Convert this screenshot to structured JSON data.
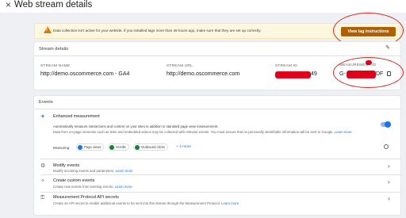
{
  "header": {
    "close_icon": "×",
    "title": "Web stream details"
  },
  "banner": {
    "text": "Data collection isn't active for your website. If you installed tags more than 48 hours ago, make sure that they are set up correctly.",
    "button": "View tag instructions"
  },
  "stream_details": {
    "title": "Stream details",
    "stream_name_label": "STREAM NAME",
    "stream_name": "http://demo.oscommerce.com - GA4",
    "stream_url_label": "STREAM URL",
    "stream_url": "http://demo.oscommerce.com",
    "stream_id_label": "STREAM ID",
    "stream_id_suffix": "49",
    "measurement_id_label": "MEASUREMENT ID",
    "measurement_id_prefix": "G-",
    "measurement_id_suffix": "DF"
  },
  "events": {
    "title": "Events",
    "enhanced": {
      "title": "Enhanced measurement",
      "desc1": "Automatically measure interactions and content on your sites in addition to standard page view measurement.",
      "desc2": "Data from on-page elements such as links and embedded videos may be collected with relevant events. You must ensure that no personally identifiable information will be sent to Google.",
      "learn_more": "Learn more",
      "measuring_label": "Measuring:",
      "chips": [
        "Page views",
        "Scrolls",
        "Outbound clicks"
      ],
      "more": "+ 4 more",
      "enabled": true
    },
    "modify": {
      "title": "Modify events",
      "desc": "Modify incoming events and parameters.",
      "learn_more": "Learn more"
    },
    "custom": {
      "title": "Create custom events",
      "desc": "Create new events from existing events.",
      "learn_more": "Learn more"
    },
    "mp": {
      "title": "Measurement Protocol API secrets",
      "desc": "Create an API secret to enable additional events to be sent into this stream through the Measurement Protocol.",
      "learn_more": "Learn more"
    }
  }
}
